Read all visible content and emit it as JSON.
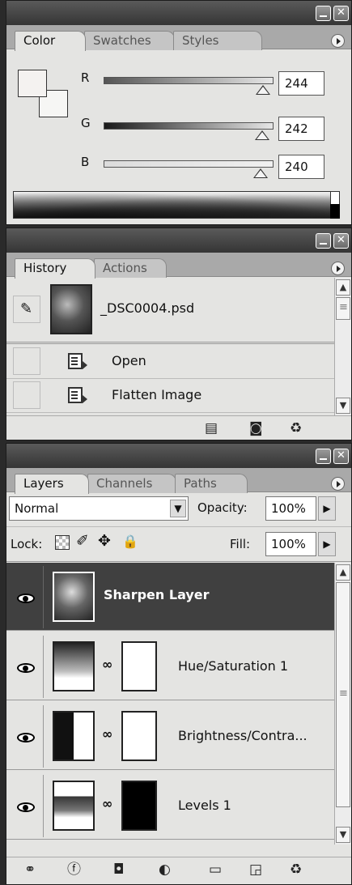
{
  "color_panel": {
    "tabs": [
      "Color",
      "Swatches",
      "Styles"
    ],
    "channels": [
      {
        "label": "R",
        "value": "244",
        "level": 0.957
      },
      {
        "label": "G",
        "value": "242",
        "level": 0.949
      },
      {
        "label": "B",
        "value": "240",
        "level": 0.941
      }
    ]
  },
  "history_panel": {
    "tabs": [
      "History",
      "Actions"
    ],
    "snapshot": "_DSC0004.psd",
    "steps": [
      "Open",
      "Flatten Image"
    ],
    "footer_icons": [
      "new-document-icon",
      "snapshot-camera-icon",
      "trash-icon"
    ]
  },
  "layers_panel": {
    "tabs": [
      "Layers",
      "Channels",
      "Paths"
    ],
    "blend_mode": "Normal",
    "opacity_label": "Opacity:",
    "opacity_value": "100%",
    "lock_label": "Lock:",
    "fill_label": "Fill:",
    "fill_value": "100%",
    "layers": [
      {
        "name": "Sharpen Layer",
        "selected": true
      },
      {
        "name": "Hue/Saturation 1"
      },
      {
        "name": "Brightness/Contra..."
      },
      {
        "name": "Levels 1"
      }
    ],
    "footer_icons": [
      "link-icon",
      "layer-style-icon",
      "mask-icon",
      "adjustment-icon",
      "folder-icon",
      "new-layer-icon",
      "trash-icon"
    ]
  }
}
